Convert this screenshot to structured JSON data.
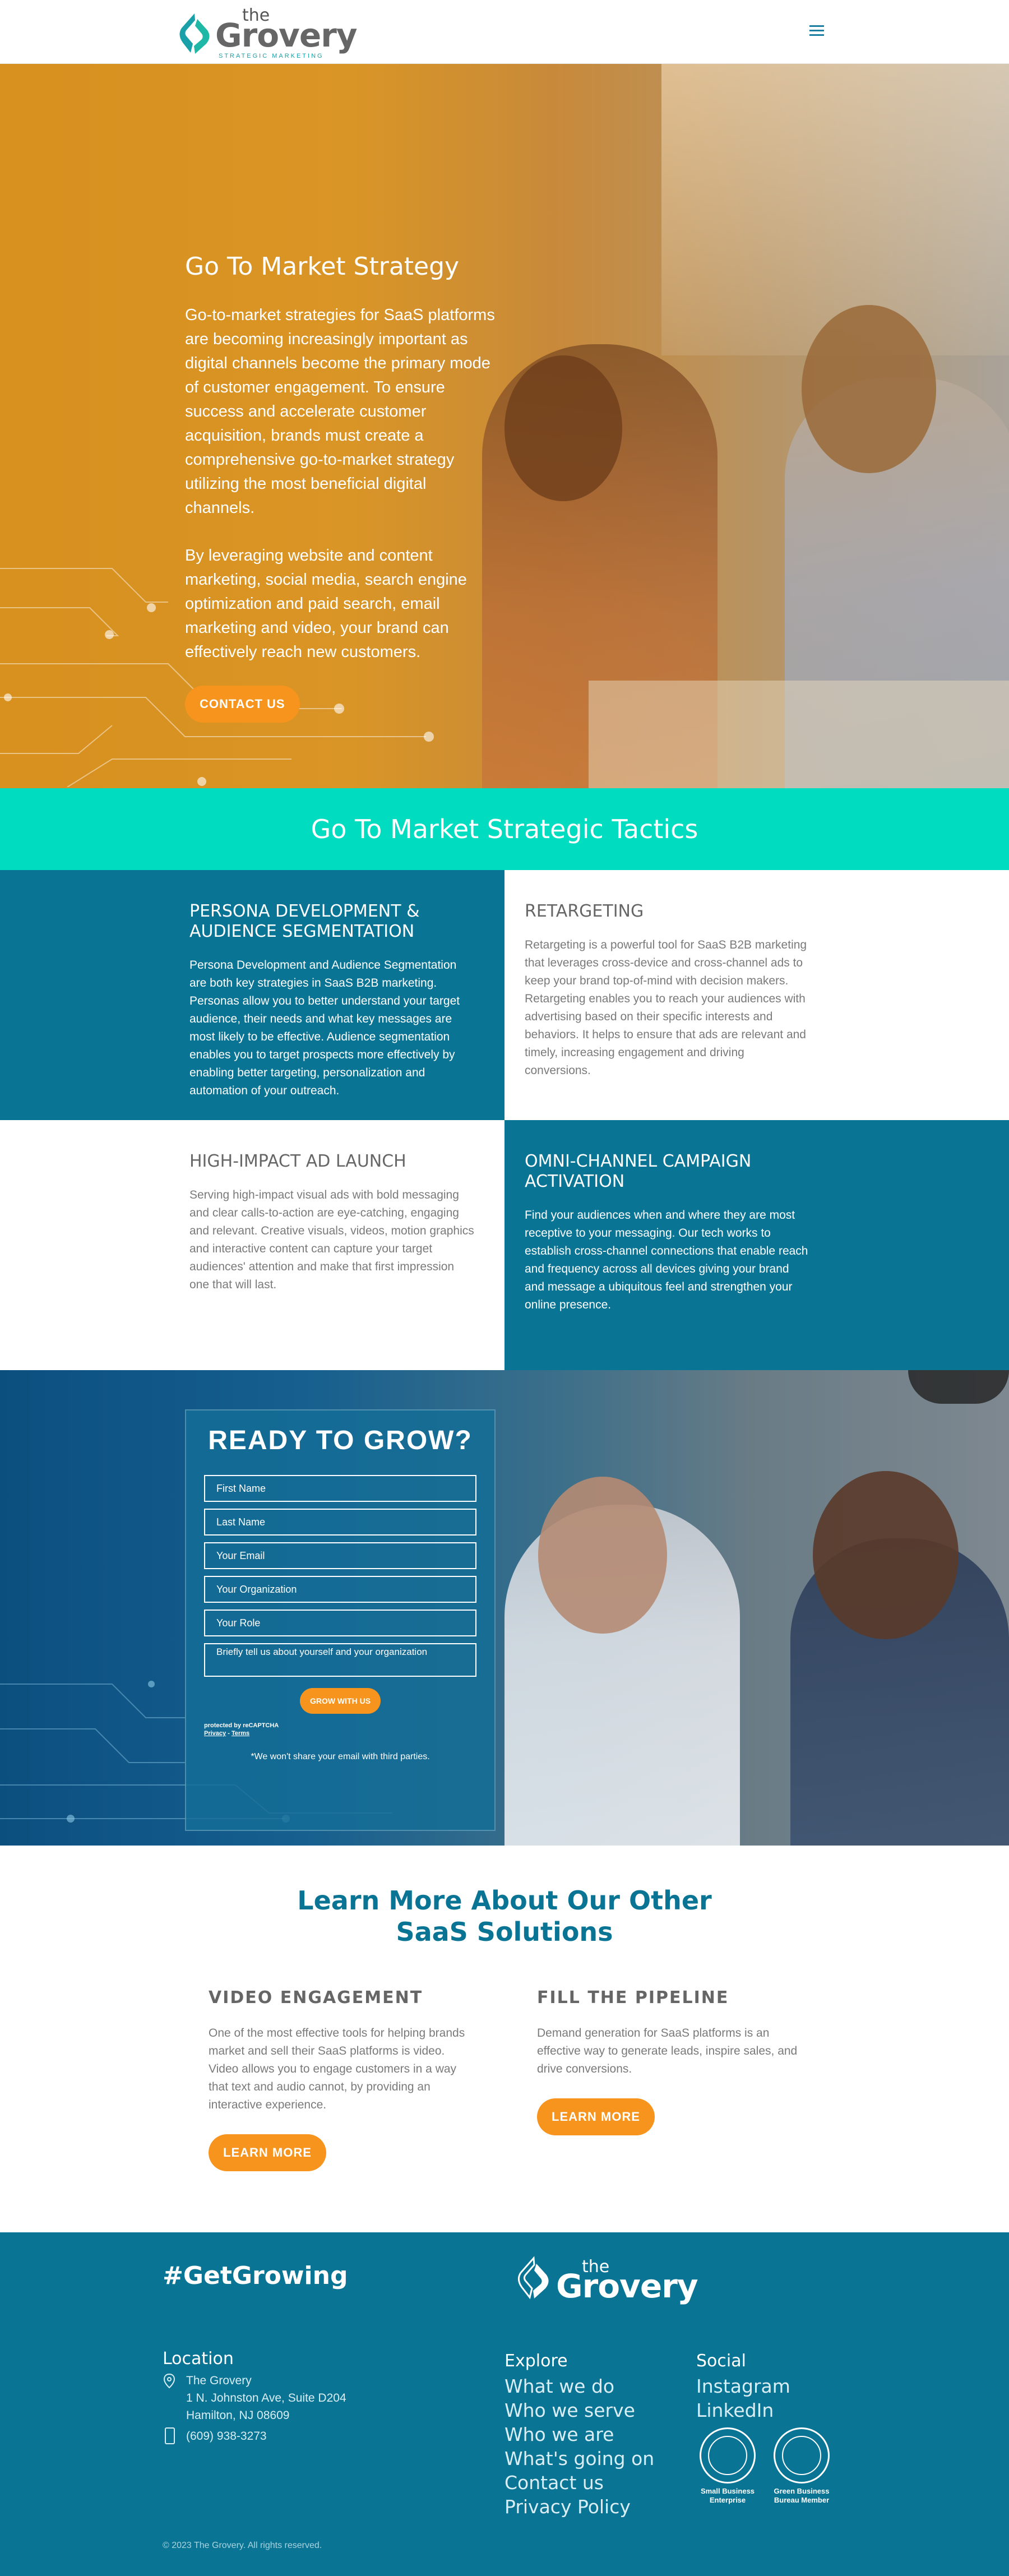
{
  "header": {
    "logo_the": "the",
    "logo_name": "Grovery",
    "logo_sub": "STRATEGIC MARKETING",
    "menu_icon": "hamburger-menu-icon"
  },
  "hero": {
    "title": "Go To Market Strategy",
    "p1": "Go-to-market strategies for SaaS platforms are becoming increasingly important as digital channels become the primary mode of customer engagement. To ensure success and accelerate customer acquisition, brands must create a comprehensive go-to-market strategy utilizing the most beneficial digital channels.",
    "p2": "By leveraging website and content marketing, social media, search engine optimization and paid search, email marketing and video, your brand can effectively reach new customers.",
    "cta": "CONTACT US"
  },
  "tactics": {
    "heading": "Go To Market Strategic Tactics",
    "items": [
      {
        "title": "PERSONA DEVELOPMENT & AUDIENCE SEGMENTATION",
        "body": "Persona Development and Audience Segmentation are both key strategies in SaaS B2B marketing. Personas allow you to better understand your target audience, their needs and what key messages are most likely to be effective. Audience segmentation enables you to target prospects more effectively by enabling better targeting, personalization and automation of your outreach."
      },
      {
        "title": "RETARGETING",
        "body": "Retargeting is a powerful tool for SaaS B2B marketing that leverages cross-device and cross-channel ads to keep your brand top-of-mind with decision makers. Retargeting enables you to reach your audiences with advertising based on their specific interests and behaviors. It helps to ensure that ads are relevant and timely, increasing engagement and driving conversions."
      },
      {
        "title": "HIGH-IMPACT AD LAUNCH",
        "body": "Serving high-impact visual ads with bold messaging and clear calls-to-action are eye-catching, engaging and relevant. Creative visuals, videos, motion graphics and interactive content can capture your target audiences' attention and make that first impression one that will last."
      },
      {
        "title": "OMNI-CHANNEL CAMPAIGN ACTIVATION",
        "body": "Find your audiences when and where they are most receptive to your messaging. Our tech works to establish cross-channel connections that enable reach and frequency across all devices giving your brand and message a ubiquitous feel and strengthen your online presence."
      }
    ]
  },
  "form": {
    "title": "READY TO GROW?",
    "fields": [
      "First Name",
      "Last Name",
      "Your Email",
      "Your Organization",
      "Your Role"
    ],
    "message": "Briefly tell us about yourself and your organization",
    "submit": "GROW WITH US",
    "recaptcha": "protected by reCAPTCHA",
    "privacy": "Privacy",
    "terms": "Terms",
    "note": "*We won't share your email with third parties."
  },
  "learn": {
    "heading_line1": "Learn More About Our Other",
    "heading_line2": "SaaS Solutions",
    "cols": [
      {
        "title": "VIDEO ENGAGEMENT",
        "body": "One of the most effective tools for helping brands market and sell their SaaS platforms is video. Video allows you to engage customers in a way that text and audio cannot, by providing an interactive experience.",
        "button": "LEARN MORE"
      },
      {
        "title": "FILL THE PIPELINE",
        "body": "Demand generation for SaaS platforms is an effective way to generate leads, inspire sales, and drive conversions.",
        "button": "LEARN MORE"
      }
    ]
  },
  "footer": {
    "tag": "#GetGrowing",
    "logo_the": "the",
    "logo_name": "Grovery",
    "location_heading": "Location",
    "location_lines": [
      "The Grovery",
      "1 N. Johnston Ave, Suite D204",
      "Hamilton, NJ 08609"
    ],
    "phone": "(609) 938-3273",
    "explore_heading": "Explore",
    "explore_links": [
      "What we do",
      "Who we serve",
      "Who we are",
      "What's going on",
      "Contact us",
      "Privacy Policy"
    ],
    "social_heading": "Social",
    "social_links": [
      "Instagram",
      "LinkedIn"
    ],
    "badge1": [
      "Small Business",
      "Enterprise"
    ],
    "badge2": [
      "Green Business",
      "Bureau Member"
    ],
    "copyright": "© 2023 The Grovery. All rights reserved."
  },
  "colors": {
    "teal_band": "#00dcbf",
    "blue": "#0a7494",
    "orange": "#f7941d"
  }
}
